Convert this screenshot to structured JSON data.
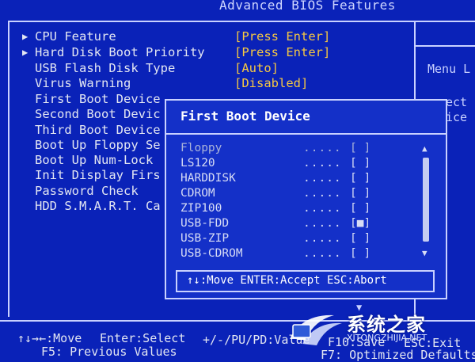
{
  "header": {
    "title": "Advanced BIOS Features"
  },
  "settings": [
    {
      "arrow": "▶",
      "label": "CPU Feature",
      "value": "[Press Enter]"
    },
    {
      "arrow": "▶",
      "label": "Hard Disk Boot Priority",
      "value": "[Press Enter]"
    },
    {
      "arrow": "",
      "label": "USB Flash Disk Type",
      "value": "[Auto]"
    },
    {
      "arrow": "",
      "label": "Virus Warning",
      "value": "[Disabled]"
    },
    {
      "arrow": "",
      "label": "First Boot Device",
      "value": ""
    },
    {
      "arrow": "",
      "label": "Second Boot Devic",
      "value": ""
    },
    {
      "arrow": "",
      "label": "Third Boot Device",
      "value": ""
    },
    {
      "arrow": "",
      "label": "Boot Up Floppy Se",
      "value": ""
    },
    {
      "arrow": "",
      "label": "Boot Up Num-Lock",
      "value": ""
    },
    {
      "arrow": "",
      "label": "Init Display Firs",
      "value": ""
    },
    {
      "arrow": "",
      "label": "Password Check",
      "value": ""
    },
    {
      "arrow": "",
      "label": "HDD S.M.A.R.T. Ca",
      "value": ""
    }
  ],
  "help": {
    "title": "Menu L",
    "frag1": "ect",
    "frag2": "ice"
  },
  "popup": {
    "title": "First Boot Device",
    "items": [
      {
        "name": "Floppy",
        "dots": ".....",
        "box": "[ ]"
      },
      {
        "name": "LS120",
        "dots": ".....",
        "box": "[ ]"
      },
      {
        "name": "HARDDISK",
        "dots": ".....",
        "box": "[ ]"
      },
      {
        "name": "CDROM",
        "dots": ".....",
        "box": "[ ]"
      },
      {
        "name": "ZIP100",
        "dots": ".....",
        "box": "[ ]"
      },
      {
        "name": "USB-FDD",
        "dots": ".....",
        "box": "[■]"
      },
      {
        "name": "USB-ZIP",
        "dots": ".....",
        "box": "[ ]"
      },
      {
        "name": "USB-CDROM",
        "dots": ".....",
        "box": "[ ]"
      }
    ],
    "footer": "↑↓:Move ENTER:Accept ESC:Abort"
  },
  "bottom": {
    "move": "↑↓→←:Move",
    "enter": "Enter:Select",
    "pupd": "+/-/PU/PD:Value",
    "f10": "F10:Save",
    "esc": "ESC:Exit",
    "f5": "F5: Previous Values",
    "f7": "F7: Optimized Defaults"
  },
  "watermark": {
    "text": "系统之家",
    "url": "XITONGZHIJIA.NET"
  },
  "colors": {
    "background": "#0a22b8",
    "value": "#f6c842",
    "popup_bg": "#1430c8",
    "frame": "#c9d1ff"
  }
}
